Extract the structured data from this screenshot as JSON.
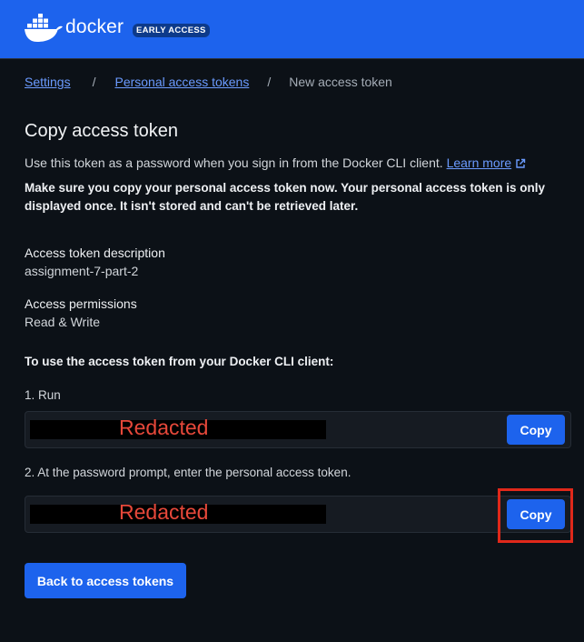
{
  "header": {
    "brand": "docker",
    "badge": "EARLY ACCESS",
    "logo_icon": "docker-whale-icon"
  },
  "breadcrumb": {
    "items": [
      "Settings",
      "Personal access tokens",
      "New access token"
    ],
    "separator": "/"
  },
  "page": {
    "title": "Copy access token",
    "intro": "Use this token as a password when you sign in from the Docker CLI client.",
    "learn_more": "Learn more",
    "warning": "Make sure you copy your personal access token now. Your personal access token is only displayed once. It isn't stored and can't be retrieved later."
  },
  "token": {
    "description_label": "Access token description",
    "description_value": "assignment-7-part-2",
    "permissions_label": "Access permissions",
    "permissions_value": "Read & Write"
  },
  "instructions": {
    "heading": "To use the access token from your Docker CLI client:",
    "step1": "1. Run",
    "step2": "2. At the password prompt, enter the personal access token.",
    "redacted": "Redacted",
    "copy_label": "Copy"
  },
  "footer": {
    "back_label": "Back to access tokens"
  },
  "colors": {
    "accent": "#1d63ed",
    "background": "#0c1117",
    "link": "#6b9bff",
    "highlight": "#e0281a"
  }
}
